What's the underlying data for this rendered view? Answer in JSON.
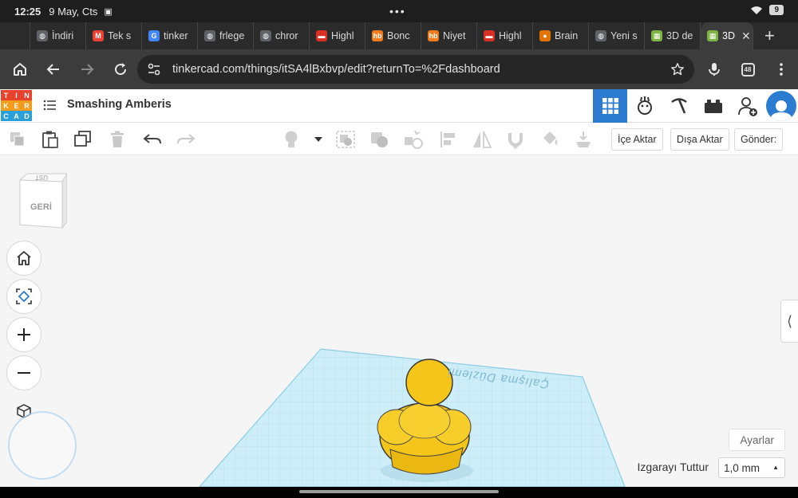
{
  "status": {
    "time": "12:25",
    "date": "9 May, Cts",
    "battery": "9"
  },
  "tabs": [
    {
      "label": "",
      "color": "#6b6b6b",
      "glyph": ""
    },
    {
      "label": "İndiri",
      "color": "#5f6368",
      "glyph": "◍"
    },
    {
      "label": "Tek s",
      "color": "#ea4335",
      "glyph": "M"
    },
    {
      "label": "tinker",
      "color": "#4285f4",
      "glyph": "G"
    },
    {
      "label": "frlege",
      "color": "#5f6368",
      "glyph": "◍"
    },
    {
      "label": "chror",
      "color": "#5f6368",
      "glyph": "◍"
    },
    {
      "label": "Highl",
      "color": "#d93025",
      "glyph": "▬"
    },
    {
      "label": "Bonc",
      "color": "#f27a1a",
      "glyph": "hb"
    },
    {
      "label": "Niyet",
      "color": "#f27a1a",
      "glyph": "hb"
    },
    {
      "label": "Highl",
      "color": "#d93025",
      "glyph": "▬"
    },
    {
      "label": "Brain",
      "color": "#e37400",
      "glyph": "●"
    },
    {
      "label": "Yeni s",
      "color": "#5f6368",
      "glyph": "◍"
    },
    {
      "label": "3D de",
      "color": "#7cb342",
      "glyph": "▦"
    },
    {
      "label": "3D",
      "color": "#7cb342",
      "glyph": "▦"
    }
  ],
  "address": {
    "url": "tinkercad.com/things/itSA4lBxbvp/edit?returnTo=%2Fdashboard",
    "tab_count": "48"
  },
  "app": {
    "logo_letters": [
      "T",
      "I",
      "N",
      "K",
      "E",
      "R",
      "C",
      "A",
      "D"
    ],
    "logo_colors": [
      "#e8412c",
      "#e8412c",
      "#e8412c",
      "#f39c1c",
      "#f39c1c",
      "#f39c1c",
      "#2b9fd9",
      "#2b9fd9",
      "#2b9fd9"
    ],
    "project_title": "Smashing Amberis",
    "accent": "#2b7bd0"
  },
  "toolbar": {
    "import_label": "İçe Aktar",
    "export_label": "Dışa Aktar",
    "send_label": "Gönder:"
  },
  "workspace": {
    "viewcube_face": "GERİ",
    "viewcube_top": "ÜST",
    "workplane_label": "Çalışma Düzlemi",
    "settings_label": "Ayarlar",
    "snap_label": "Izgarayı Tuttur",
    "snap_value": "1,0 mm",
    "shape_color": "#f5c519"
  }
}
